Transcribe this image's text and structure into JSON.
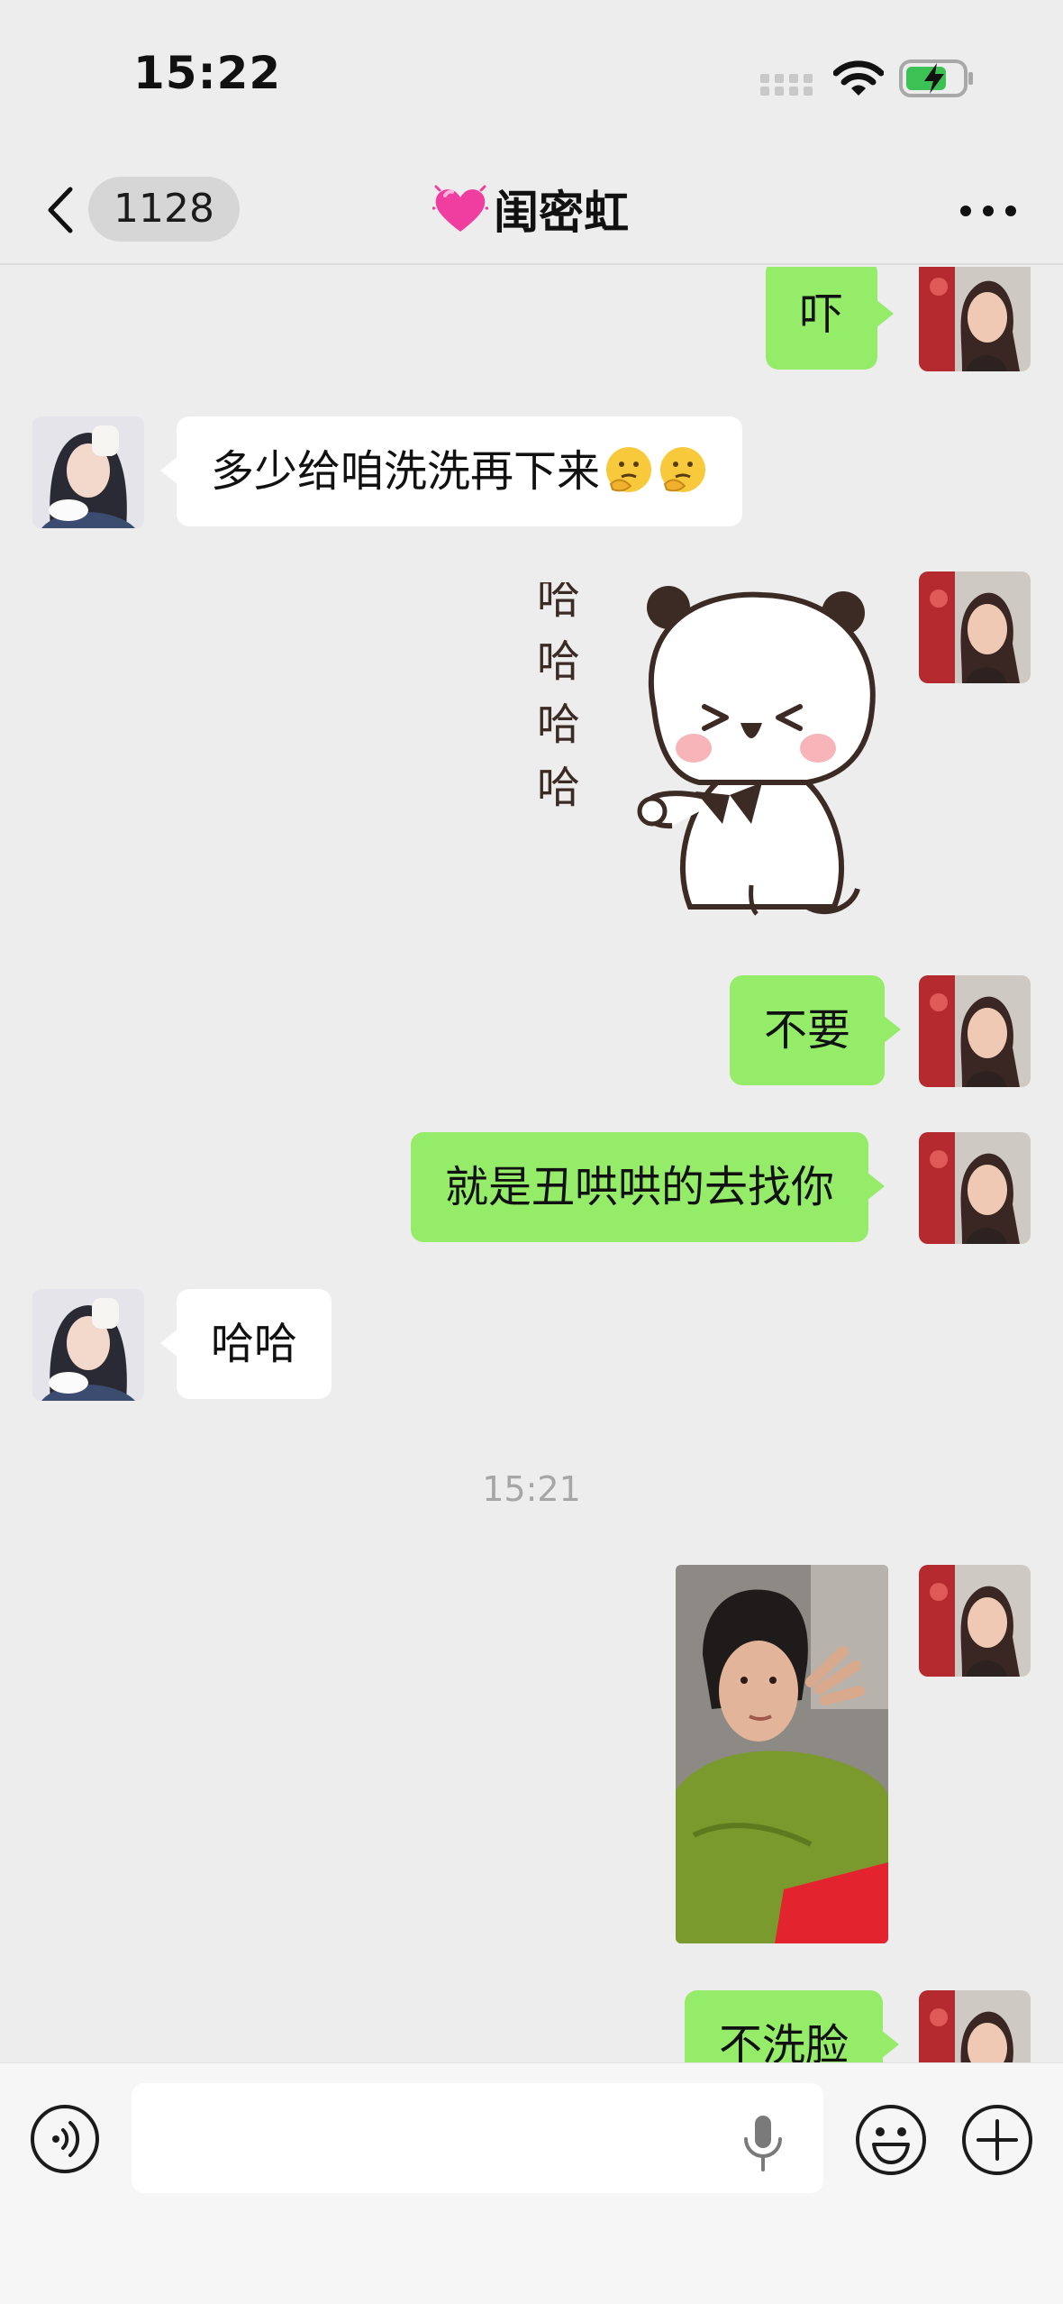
{
  "status_bar": {
    "time": "15:22"
  },
  "nav": {
    "unread_count": "1128",
    "title": "闺密虹"
  },
  "messages": {
    "m1": "吓",
    "m2": "多少给咱洗洗再下来",
    "m4": "不要",
    "m5": "就是丑哄哄的去找你",
    "m6": "哈哈",
    "timestamp": "15:21",
    "m8": "不洗脸"
  },
  "sticker": {
    "caption": [
      "哈",
      "哈",
      "哈",
      "哈"
    ]
  },
  "input": {
    "placeholder": ""
  },
  "colors": {
    "outgoing_bubble": "#95ec69",
    "incoming_bubble": "#ffffff",
    "background": "#ededed"
  }
}
